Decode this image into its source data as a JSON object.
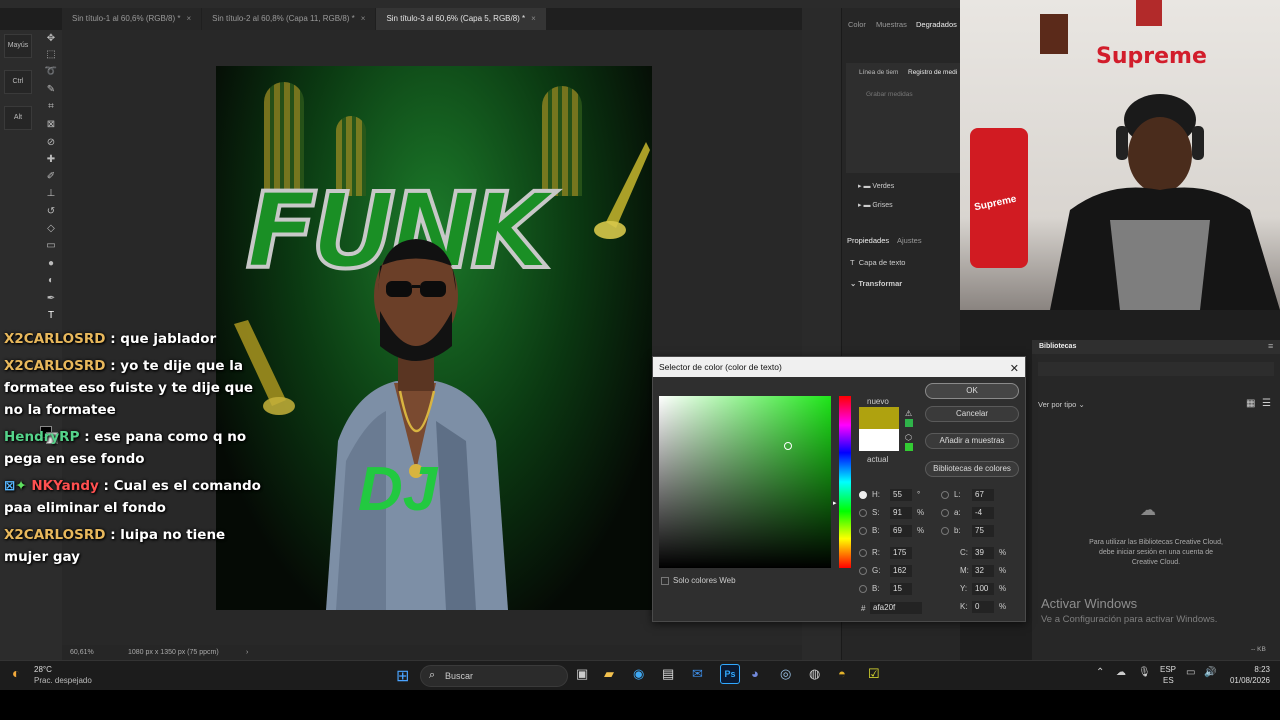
{
  "tabs": [
    {
      "label": "Sin título-1 al 60,6% (RGB/8) *",
      "active": false
    },
    {
      "label": "Sin título-2 al 60,8% (Capa 11, RGB/8) *",
      "active": false
    },
    {
      "label": "Sin título-3 al 60,6% (Capa 5, RGB/8) *",
      "active": true
    }
  ],
  "tab_close_glyph": "×",
  "modifiers": [
    "Mayús",
    "Ctrl",
    "Alt"
  ],
  "artwork": {
    "title_text": "FUNK",
    "dj_text": "DJ"
  },
  "status_bar": {
    "zoom": "60,61%",
    "doc_info": "1080 px x 1350 px (75 ppcm)"
  },
  "right_panel": {
    "top_tabs": [
      "Color",
      "Muestras",
      "Degradados"
    ],
    "sub_tabs": [
      "Línea de tiem",
      "Registro de medi"
    ],
    "grabar_label": "Grabar medidas",
    "folders": [
      "Verdes",
      "Grises"
    ],
    "props_tabs": [
      "Propiedades",
      "Ajustes"
    ],
    "layer_type": "Capa de texto",
    "transform_label": "Transformar"
  },
  "chat": [
    {
      "user": "X2CARLOSRD",
      "text": ": que jablador",
      "color": "#e8b85c"
    },
    {
      "user": "X2CARLOSRD",
      "text": ": yo te dije que la formatee eso fuiste y te dije que no la formatee",
      "color": "#e8b85c"
    },
    {
      "user": "HendryRP",
      "text": ": ese pana como q no pega en ese fondo",
      "color": "#55d38a"
    },
    {
      "user": "NKYandy",
      "text": ": Cual es el comando paa eliminar el fondo",
      "color": "#ff5050"
    },
    {
      "user": "X2CARLOSRD",
      "text": ": luipa no tiene mujer gay",
      "color": "#e8b85c"
    }
  ],
  "color_picker": {
    "title": "Selector de color (color de texto)",
    "close_glyph": "✕",
    "new_label": "nuevo",
    "current_label": "actual",
    "new_color": "#afa20f",
    "current_color": "#ffffff",
    "buttons": {
      "ok": "OK",
      "cancel": "Cancelar",
      "add": "Añadir a muestras",
      "libs": "Bibliotecas de colores"
    },
    "web_only": "Solo colores Web",
    "hsb": {
      "H": "55",
      "S": "91",
      "B": "69",
      "H_unit": "°",
      "pct": "%"
    },
    "rgb": {
      "R": "175",
      "G": "162",
      "B": "15"
    },
    "lab": {
      "L": "67",
      "a": "-4",
      "b": "75"
    },
    "cmyk": {
      "C": "39",
      "M": "32",
      "Y": "100",
      "K": "0"
    },
    "hex": "afa20f",
    "hex_label": "#"
  },
  "libraries": {
    "title": "Bibliotecas",
    "view_by": "Ver por tipo",
    "message": "Para utilizar las Bibliotecas Creative Cloud, debe iniciar sesión en una cuenta de Creative Cloud.",
    "size_label": "-- KB"
  },
  "activate_windows": {
    "title": "Activar Windows",
    "subtitle": "Ve a Configuración para activar Windows."
  },
  "webcam": {
    "sign_text": "Supreme",
    "case_text": "Supreme"
  },
  "taskbar": {
    "weather_temp": "28°C",
    "weather_desc": "Prac. despejado",
    "search_placeholder": "Buscar",
    "lang_top": "ESP",
    "lang_bottom": "ES",
    "time": "8:23",
    "date": "01/08/2026"
  }
}
